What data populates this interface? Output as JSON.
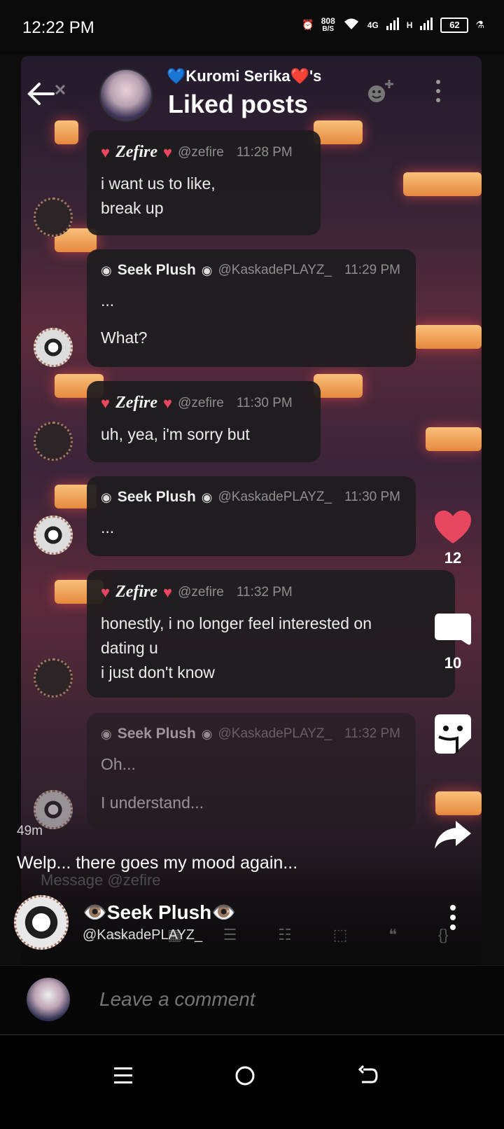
{
  "status_bar": {
    "time": "12:22 PM",
    "net_speed_value": "808",
    "net_speed_unit": "B/S",
    "network_type": "4G",
    "signal_h": "H",
    "battery": "62"
  },
  "header": {
    "title_owner": "💙Kuromi Serika❤️'s",
    "title": "Liked posts"
  },
  "messages": [
    {
      "author": "Zefire",
      "handle": "@zefire",
      "time": "11:28 PM",
      "lines": [
        "i want us to like,",
        "break up"
      ]
    },
    {
      "author": "Seek Plush",
      "handle": "@KaskadePLAYZ_",
      "time": "11:29 PM",
      "lines": [
        "...",
        "What?"
      ]
    },
    {
      "author": "Zefire",
      "handle": "@zefire",
      "time": "11:30 PM",
      "lines": [
        "uh, yea, i'm sorry but"
      ]
    },
    {
      "author": "Seek Plush",
      "handle": "@KaskadePLAYZ_",
      "time": "11:30 PM",
      "lines": [
        "..."
      ]
    },
    {
      "author": "Zefire",
      "handle": "@zefire",
      "time": "11:32 PM",
      "lines": [
        "honestly, i no longer feel interested on",
        "dating u",
        "i just don't know"
      ]
    },
    {
      "author": "Seek Plush",
      "handle": "@KaskadePLAYZ_",
      "time": "11:32 PM",
      "lines": [
        "Oh...",
        "I understand..."
      ]
    }
  ],
  "actions": {
    "likes": "12",
    "comments": "10"
  },
  "post": {
    "age": "49m",
    "caption": "Welp... there goes my mood again...",
    "message_placeholder": "Message @zefire",
    "author_name": "👁️Seek Plush👁️",
    "author_handle": "@KaskadePLAYZ_"
  },
  "comment": {
    "placeholder": "Leave a comment"
  },
  "colors": {
    "heart": "#e8475f",
    "background": "#0d0d0d"
  }
}
